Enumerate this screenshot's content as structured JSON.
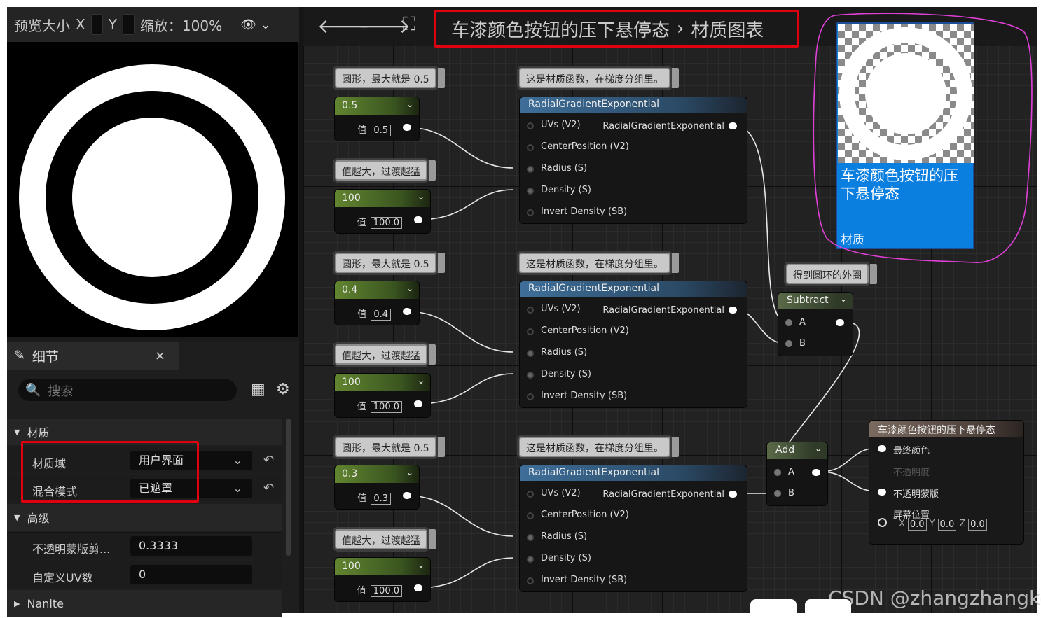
{
  "preview": {
    "title": "预览大小",
    "x_label": "X",
    "y_label": "Y",
    "zoom_label": "缩放：100%"
  },
  "details": {
    "tab_title": "细节",
    "close": "×",
    "search_placeholder": "搜索",
    "categories": {
      "material": "材质",
      "advanced": "高级",
      "nanite": "Nanite"
    },
    "rows": [
      {
        "label": "材质域",
        "value": "用户界面"
      },
      {
        "label": "混合模式",
        "value": "已遮罩"
      },
      {
        "label": "不透明蒙版剪...",
        "value": "0.3333"
      },
      {
        "label": "自定义UV数",
        "value": "0"
      }
    ]
  },
  "graph": {
    "breadcrumb_asset": "车漆颜色按钮的压下悬停态",
    "breadcrumb_sep": "›",
    "breadcrumb_page": "材质图表",
    "comments": {
      "circle_max": "圆形，最大就是 0.5",
      "value_bigger": "值越大，过渡越猛",
      "mat_func": "这是材质函数，在梯度分组里。",
      "outer_ring": "得到圆环的外圈"
    },
    "value_label": "值",
    "const_nodes": [
      {
        "title": "0.5",
        "value": "0.5"
      },
      {
        "title": "100",
        "value": "100.0"
      },
      {
        "title": "0.4",
        "value": "0.4"
      },
      {
        "title": "100",
        "value": "100.0"
      },
      {
        "title": "0.3",
        "value": "0.3"
      },
      {
        "title": "100",
        "value": "100.0"
      }
    ],
    "radial": {
      "title": "RadialGradientExponential",
      "inputs": [
        "UVs (V2)",
        "CenterPosition (V2)",
        "Radius (S)",
        "Density (S)",
        "Invert Density (SB)"
      ],
      "output": "RadialGradientExponential"
    },
    "subtract": {
      "title": "Subtract",
      "a": "A",
      "b": "B"
    },
    "add": {
      "title": "Add",
      "a": "A",
      "b": "B"
    },
    "material": {
      "title": "车漆颜色按钮的压下悬停态",
      "final_color": "最终颜色",
      "opacity": "不透明度",
      "opacity_mask": "不透明蒙版",
      "screen_pos": "屏幕位置",
      "x": "X",
      "y": "Y",
      "z": "Z",
      "xv": "0.0",
      "yv": "0.0",
      "zv": "0.0"
    }
  },
  "tile": {
    "name": "车漆颜色按钮的压下悬停态",
    "type": "材质"
  },
  "watermark": "CSDN @zhangzhangkeji",
  "colors": {
    "accent_blue": "#0a7fe0",
    "highlight_red": "#e00010",
    "annotation_pink": "#e040d8"
  }
}
